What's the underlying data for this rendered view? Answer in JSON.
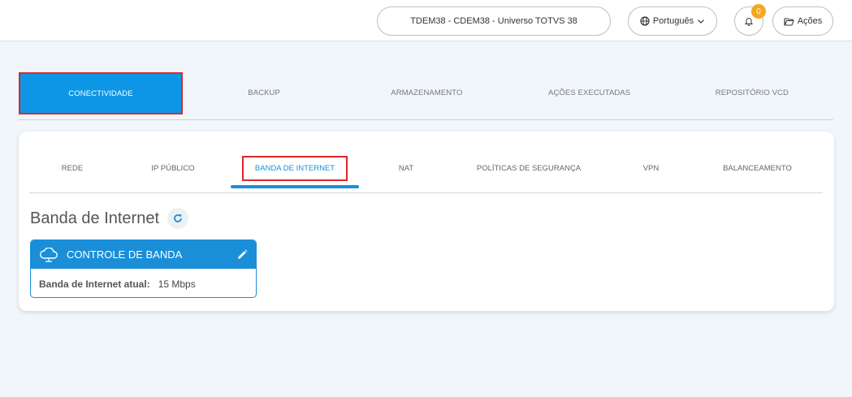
{
  "header": {
    "context": "TDEM38 - CDEM38 - Universo TOTVS 38",
    "language": "Português",
    "notifications_count": "0",
    "actions_label": "Ações"
  },
  "main_tabs": [
    {
      "label": "CONECTIVIDADE",
      "active": true
    },
    {
      "label": "BACKUP",
      "active": false
    },
    {
      "label": "ARMAZENAMENTO",
      "active": false
    },
    {
      "label": "AÇÕES EXECUTADAS",
      "active": false
    },
    {
      "label": "REPOSITÓRIO VCD",
      "active": false
    }
  ],
  "sub_tabs": [
    {
      "label": "REDE",
      "active": false
    },
    {
      "label": "IP PÚBLICO",
      "active": false
    },
    {
      "label": "BANDA DE INTERNET",
      "active": true
    },
    {
      "label": "NAT",
      "active": false
    },
    {
      "label": "POLÍTICAS DE SEGURANÇA",
      "active": false
    },
    {
      "label": "VPN",
      "active": false
    },
    {
      "label": "BALANCEAMENTO",
      "active": false
    }
  ],
  "section": {
    "title": "Banda de Internet"
  },
  "bandwidth_card": {
    "title": "CONTROLE DE BANDA",
    "key": "Banda de Internet atual:",
    "value": "15 Mbps"
  },
  "colors": {
    "accent": "#1a8fd8",
    "active_tab": "#0d96e6",
    "highlight_border": "#e0262a",
    "badge": "#f5a623"
  },
  "icons": {
    "language": "globe-icon",
    "notifications": "bell-icon",
    "actions": "folder-open-icon",
    "refresh": "refresh-icon",
    "card": "cloud-icon",
    "edit": "pencil-icon",
    "dropdown": "chevron-down-icon"
  }
}
